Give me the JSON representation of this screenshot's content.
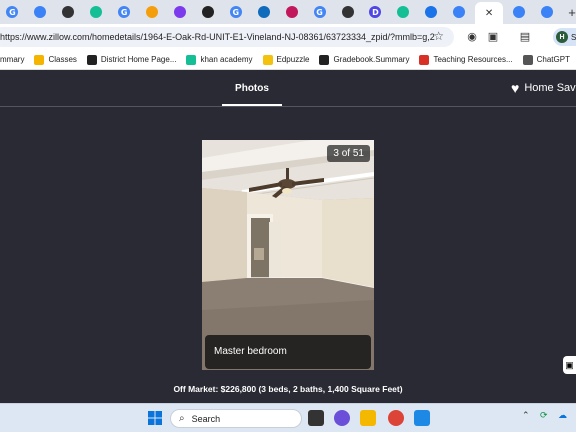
{
  "browser": {
    "tabs": [
      {
        "icon": "google-icon",
        "letter": "G",
        "color": "#4285f4"
      },
      {
        "icon": "drive-icon",
        "letter": "",
        "color": "#3b82f6"
      },
      {
        "icon": "github-icon",
        "letter": "",
        "color": "#333333"
      },
      {
        "icon": "khan-icon",
        "letter": "",
        "color": "#14bf96"
      },
      {
        "icon": "google-icon",
        "letter": "G",
        "color": "#4285f4"
      },
      {
        "icon": "orange-icon",
        "letter": "",
        "color": "#f59e0b"
      },
      {
        "icon": "purple-icon",
        "letter": "",
        "color": "#7c3aed"
      },
      {
        "icon": "black-icon",
        "letter": "",
        "color": "#222222"
      },
      {
        "icon": "google-icon",
        "letter": "G",
        "color": "#4285f4"
      },
      {
        "icon": "outlook-icon",
        "letter": "",
        "color": "#0f6cbd"
      },
      {
        "icon": "red-icon",
        "letter": "",
        "color": "#c2185b"
      },
      {
        "icon": "google-icon",
        "letter": "G",
        "color": "#4285f4"
      },
      {
        "icon": "github-icon",
        "letter": "",
        "color": "#333333"
      },
      {
        "icon": "docs-icon",
        "letter": "D",
        "color": "#4f46e5"
      },
      {
        "icon": "khan-icon",
        "letter": "",
        "color": "#14bf96"
      },
      {
        "icon": "search-icon",
        "letter": "",
        "color": "#1a73e8"
      },
      {
        "icon": "drive-icon",
        "letter": "",
        "color": "#3b82f6"
      },
      {
        "icon": "drive-icon",
        "letter": "",
        "color": "#3b82f6"
      },
      {
        "icon": "drive-icon",
        "letter": "",
        "color": "#3b82f6"
      }
    ],
    "active_tab_close": "✕",
    "new_tab": "+",
    "url": "https://www.zillow.com/homedetails/1964-E-Oak-Rd-UNIT-E1-Vineland-NJ-08361/63723334_zpid/?mmlb=g,2",
    "profile_initial": "H",
    "profile_label": "Sc"
  },
  "bookmarks": [
    {
      "label": "mmary",
      "icon": "",
      "color": "#ffffff"
    },
    {
      "label": "Classes",
      "icon": "classroom-icon",
      "color": "#f4b400"
    },
    {
      "label": "District Home Page...",
      "icon": "district-icon",
      "color": "#222222"
    },
    {
      "label": "khan academy",
      "icon": "khan-icon",
      "color": "#14bf96"
    },
    {
      "label": "Edpuzzle",
      "icon": "edpuzzle-icon",
      "color": "#f4c20d"
    },
    {
      "label": "Gradebook.Summary",
      "icon": "gradebook-icon",
      "color": "#222222"
    },
    {
      "label": "Teaching Resources...",
      "icon": "teaching-icon",
      "color": "#d93025"
    },
    {
      "label": "ChatGPT",
      "icon": "chatgpt-icon",
      "color": "#555555"
    }
  ],
  "viewer": {
    "title": "Photos",
    "save_label": "Home Sav",
    "counter": "3 of 51",
    "caption": "Master bedroom",
    "listing": "Off Market: $226,800 (3 beds, 2 baths, 1,400 Square Feet)"
  },
  "taskbar": {
    "search_label": "Search"
  }
}
